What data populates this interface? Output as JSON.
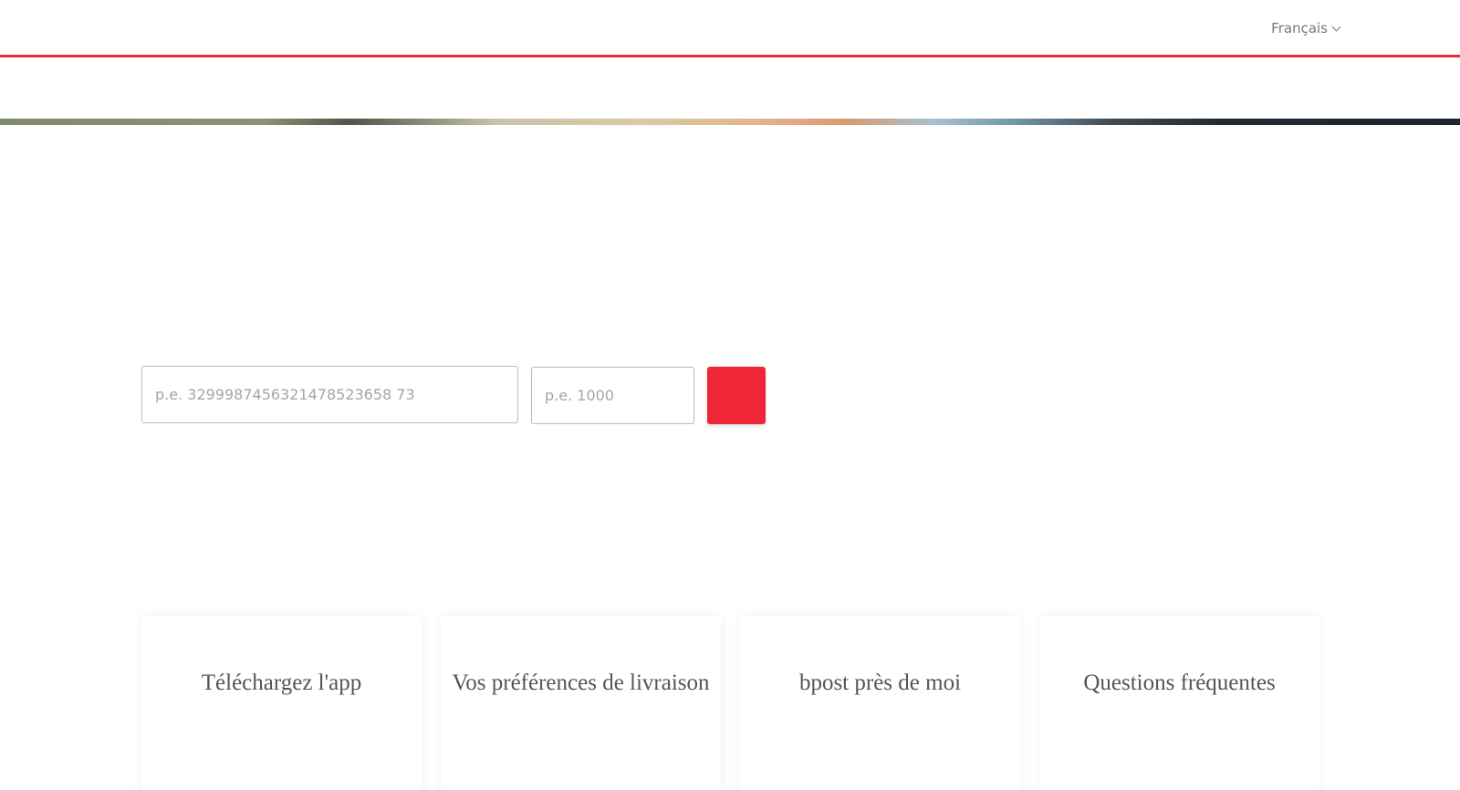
{
  "header": {
    "language_label": "Français"
  },
  "search": {
    "tracking_placeholder": "p.e. 3299987456321478523658 73",
    "postal_placeholder": "p.e. 1000"
  },
  "cards": [
    {
      "title": "Téléchargez l'app"
    },
    {
      "title": "Vos préférences de livraison"
    },
    {
      "title": "bpost près de moi"
    },
    {
      "title": "Questions fréquentes"
    }
  ],
  "colors": {
    "accent_red": "#ef2637",
    "rule_red": "#e52d3b"
  }
}
